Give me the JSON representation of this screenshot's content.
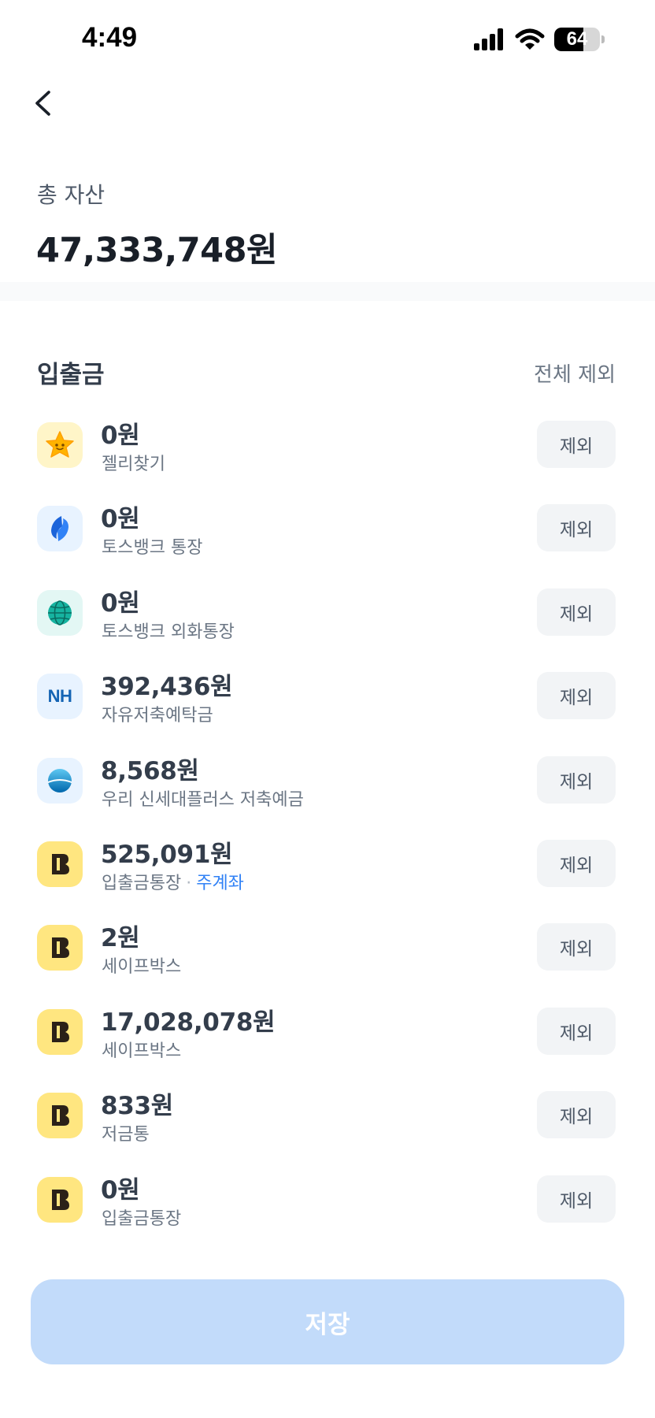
{
  "status_bar": {
    "time": "4:49",
    "battery_level": "64",
    "battery_fraction": 0.64
  },
  "header": {
    "total_label": "총 자산",
    "total_value": "47,333,748원"
  },
  "section": {
    "title": "입출금",
    "exclude_all_label": "전체 제외"
  },
  "accounts": [
    {
      "amount": "0원",
      "name": "젤리찾기",
      "icon": "star-jelly-icon"
    },
    {
      "amount": "0원",
      "name": "토스뱅크 통장",
      "icon": "toss-bank-icon"
    },
    {
      "amount": "0원",
      "name": "토스뱅크 외화통장",
      "icon": "globe-icon"
    },
    {
      "amount": "392,436원",
      "name": "자유저축예탁금",
      "icon": "nh-bank-icon",
      "icon_text": "NH"
    },
    {
      "amount": "8,568원",
      "name": "우리 신세대플러스 저축예금",
      "icon": "woori-bank-icon"
    },
    {
      "amount": "525,091원",
      "name": "입출금통장",
      "icon": "kakao-bank-icon",
      "separator": "·",
      "tag": "주계좌"
    },
    {
      "amount": "2원",
      "name": "세이프박스",
      "icon": "kakao-bank-icon"
    },
    {
      "amount": "17,028,078원",
      "name": "세이프박스",
      "icon": "kakao-bank-icon"
    },
    {
      "amount": "833원",
      "name": "저금통",
      "icon": "kakao-bank-icon"
    },
    {
      "amount": "0원",
      "name": "입출금통장",
      "icon": "kakao-bank-icon"
    }
  ],
  "exclude_button_label": "제외",
  "save_button_label": "저장",
  "colors": {
    "primary_disabled": "#c2dbfa",
    "link_blue": "#3182f6",
    "button_gray": "#f2f4f6"
  }
}
